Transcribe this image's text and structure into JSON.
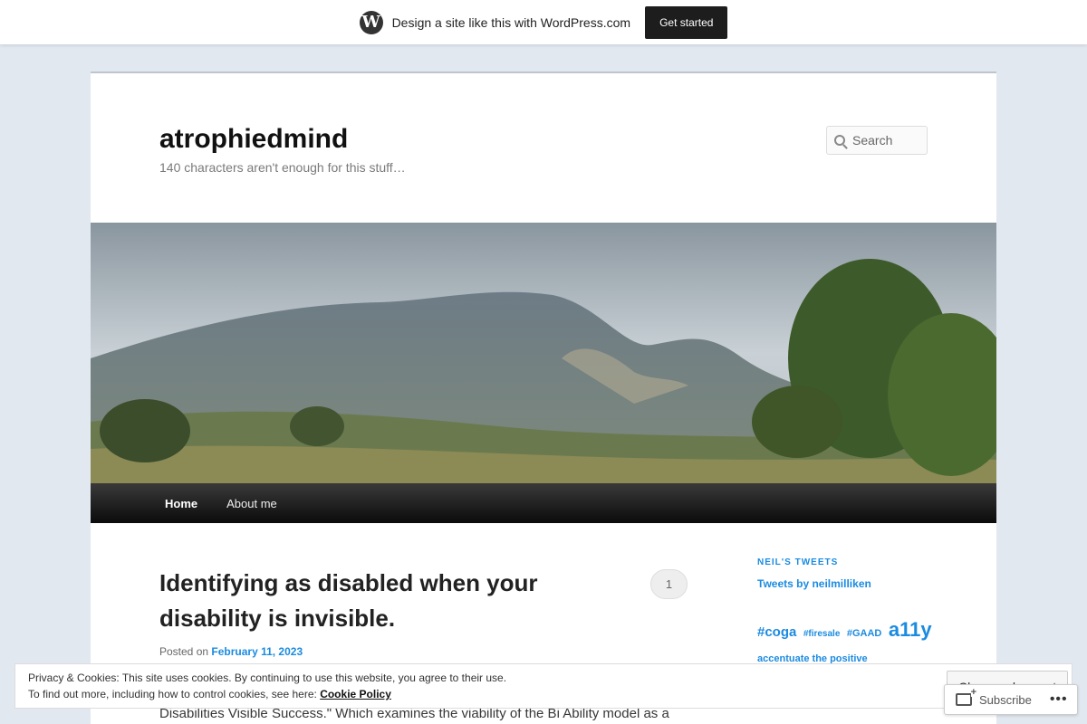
{
  "wpbar": {
    "text": "Design a site like this with WordPress.com",
    "cta": "Get started",
    "logo_letter": "W"
  },
  "site": {
    "title": "atrophiedmind",
    "tagline": "140 characters aren't enough for this stuff…"
  },
  "search": {
    "placeholder": "Search"
  },
  "nav": {
    "items": [
      "Home",
      "About me"
    ]
  },
  "post": {
    "title": "Identifying as disabled when your disability is invisible.",
    "comment_count": "1",
    "posted_on": "Posted on",
    "date": "February 11, 2023",
    "excerpt": "Disabilities Visible Success.\" Which examines the viability of the Bi Ability model as a"
  },
  "sidebar": {
    "widget_title": "NEIL'S TWEETS",
    "tweets_link": "Tweets by neilmilliken",
    "tags": [
      "#coga",
      "#firesale",
      "#GAAD",
      "a11y",
      "accentuate the positive"
    ]
  },
  "cookie": {
    "line1": "Privacy & Cookies: This site uses cookies. By continuing to use this website, you agree to their use.",
    "line2_prefix": "To find out more, including how to control cookies, see here: ",
    "policy_link": "Cookie Policy",
    "button": "Close and accept"
  },
  "subscribe": {
    "label": "Subscribe",
    "more": "•••"
  }
}
